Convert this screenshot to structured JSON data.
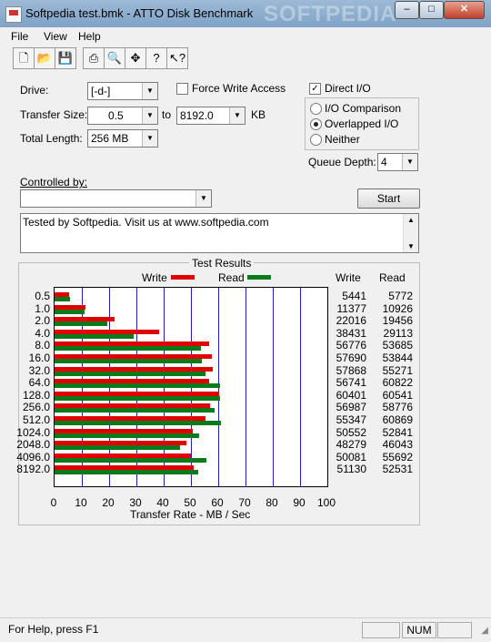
{
  "window": {
    "title": "Softpedia test.bmk - ATTO Disk Benchmark",
    "watermark": "SOFTPEDIA"
  },
  "menu": [
    "File",
    "View",
    "Help"
  ],
  "toolbar": [
    "new-icon",
    "open-icon",
    "save-icon",
    "print-icon",
    "print-preview-icon",
    "move-icon",
    "help-icon",
    "context-help-icon"
  ],
  "form": {
    "drive_label": "Drive:",
    "drive_value": "[-d-]",
    "force_write_label": "Force Write Access",
    "force_write_checked": false,
    "direct_io_label": "Direct I/O",
    "direct_io_checked": true,
    "transfer_size_label": "Transfer Size:",
    "transfer_from": "0.5",
    "to_label": "to",
    "transfer_to": "8192.0",
    "unit": "KB",
    "total_length_label": "Total Length:",
    "total_length": "256 MB",
    "io_comparison": "I/O Comparison",
    "overlapped_io": "Overlapped I/O",
    "neither": "Neither",
    "queue_depth_label": "Queue Depth:",
    "queue_depth": "4",
    "controlled_by_label": "Controlled by:",
    "controlled_by_value": "",
    "start_label": "Start",
    "description": "Tested by Softpedia. Visit us at www.softpedia.com"
  },
  "results": {
    "title": "Test Results",
    "legend_write": "Write",
    "legend_read": "Read",
    "col_write": "Write",
    "col_read": "Read",
    "xlabel": "Transfer Rate - MB / Sec",
    "colors": {
      "write": "#e00000",
      "read": "#0a7a1a"
    }
  },
  "chart_data": {
    "type": "bar",
    "categories": [
      "0.5",
      "1.0",
      "2.0",
      "4.0",
      "8.0",
      "16.0",
      "32.0",
      "64.0",
      "128.0",
      "256.0",
      "512.0",
      "1024.0",
      "2048.0",
      "4096.0",
      "8192.0"
    ],
    "series": [
      {
        "name": "Write",
        "values": [
          5441,
          11377,
          22016,
          38431,
          56776,
          57690,
          57868,
          56741,
          60401,
          56987,
          55347,
          50552,
          48279,
          50081,
          51130
        ]
      },
      {
        "name": "Read",
        "values": [
          5772,
          10926,
          19456,
          29113,
          53685,
          53844,
          55271,
          60822,
          60541,
          58776,
          60869,
          52841,
          46043,
          55692,
          52531
        ]
      }
    ],
    "xticks": [
      "0",
      "10",
      "20",
      "30",
      "40",
      "50",
      "60",
      "70",
      "80",
      "90",
      "100"
    ],
    "xlim": [
      0,
      100
    ],
    "xlabel": "Transfer Rate - MB / Sec",
    "orientation": "horizontal"
  },
  "status": {
    "help": "For Help, press F1",
    "num": "NUM"
  }
}
